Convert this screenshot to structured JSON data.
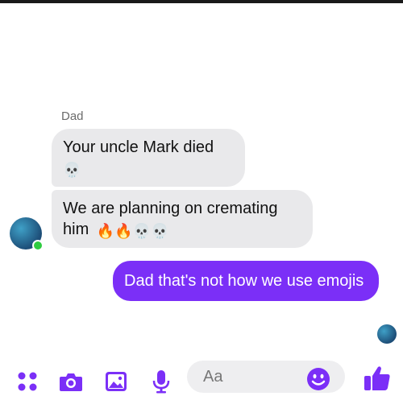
{
  "conversation": {
    "sender_name": "Dad",
    "messages_in": [
      {
        "text": "Your uncle Mark died",
        "emojis": "💀"
      },
      {
        "text": "We are planning on cremating him",
        "emojis": "🔥🔥💀💀"
      }
    ],
    "message_out": {
      "text": "Dad that's not how we use emojis"
    }
  },
  "composer": {
    "placeholder": "Aa",
    "icons": [
      "apps-grid-icon",
      "camera-icon",
      "image-icon",
      "microphone-icon",
      "emoji-icon",
      "thumbs-up-icon"
    ]
  },
  "colors": {
    "accent": "#7b2ff7",
    "incoming_bubble": "#e9e9eb",
    "online": "#2ecc40"
  }
}
